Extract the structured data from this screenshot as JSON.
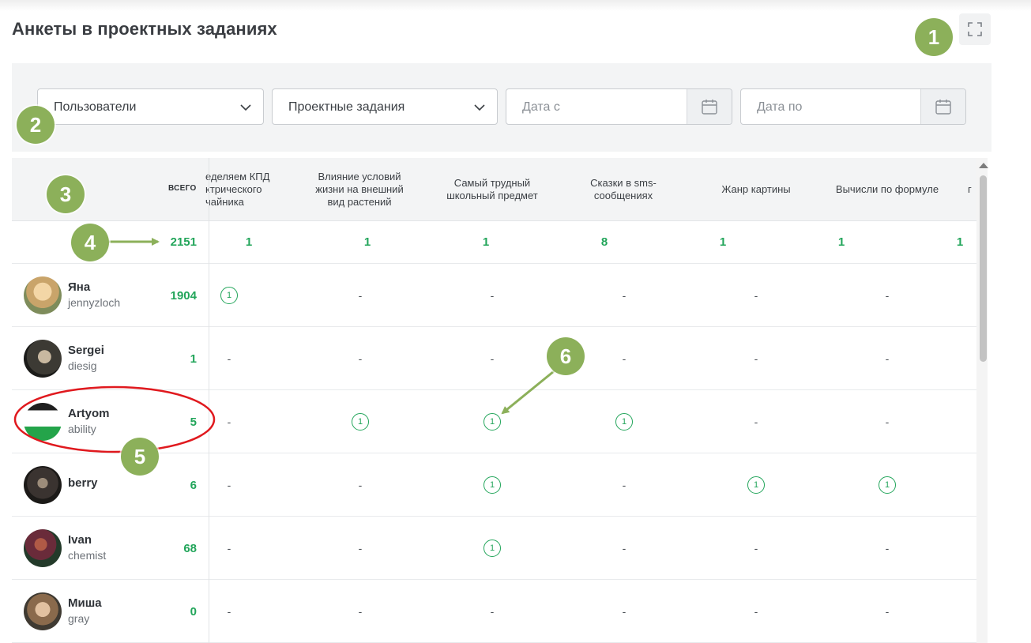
{
  "page": {
    "title": "Анкеты в проектных заданиях"
  },
  "filters": {
    "users_select": "Пользователи",
    "tasks_select": "Проектные задания",
    "date_from_placeholder": "Дата с",
    "date_to_placeholder": "Дата по"
  },
  "table": {
    "total_header": "ВСЕГО",
    "columns": [
      "еделяем КПД ктрического чайника",
      "Влияние условий жизни на внешний вид растений",
      "Самый трудный школьный предмет",
      "Сказки в sms-сообщениях",
      "Жанр картины",
      "Вычисли по формуле",
      "г"
    ],
    "totals": {
      "all": "2151",
      "by_column": [
        "1",
        "1",
        "1",
        "8",
        "1",
        "1",
        "1"
      ]
    },
    "rows": [
      {
        "name": "Яна",
        "login": "jennyzloch",
        "total": "1904",
        "cells": [
          "1",
          "-",
          "-",
          "-",
          "-",
          "-"
        ]
      },
      {
        "name": "Sergei",
        "login": "diesig",
        "total": "1",
        "cells": [
          "-",
          "-",
          "-",
          "-",
          "-",
          "-"
        ]
      },
      {
        "name": "Artyom",
        "login": "ability",
        "total": "5",
        "cells": [
          "-",
          "1",
          "1",
          "1",
          "-",
          "-"
        ]
      },
      {
        "name": "berry",
        "login": "",
        "total": "6",
        "cells": [
          "-",
          "-",
          "1",
          "-",
          "1",
          "1"
        ]
      },
      {
        "name": "Ivan",
        "login": "chemist",
        "total": "68",
        "cells": [
          "-",
          "-",
          "1",
          "-",
          "-",
          "-"
        ]
      },
      {
        "name": "Миша",
        "login": "gray",
        "total": "0",
        "cells": [
          "-",
          "-",
          "-",
          "-",
          "-",
          "-"
        ]
      }
    ]
  },
  "annotations": {
    "markers": [
      "1",
      "2",
      "3",
      "4",
      "5",
      "6"
    ],
    "marker_color": "#8cb05a",
    "arrow_color": "#8cb05a",
    "highlight_color": "#e0191e"
  },
  "colors": {
    "accent_green": "#22a55a",
    "panel_bg": "#f3f4f5"
  }
}
